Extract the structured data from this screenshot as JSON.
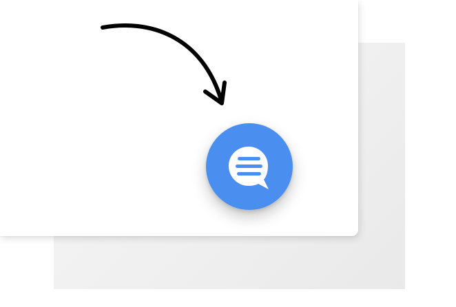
{
  "colors": {
    "accent": "#4a8ff0",
    "icon_bubble": "#ffffff",
    "arrow": "#000000"
  },
  "chat_launcher": {
    "icon": "chat-bubble-icon"
  },
  "annotation": {
    "icon": "curved-arrow-icon"
  }
}
